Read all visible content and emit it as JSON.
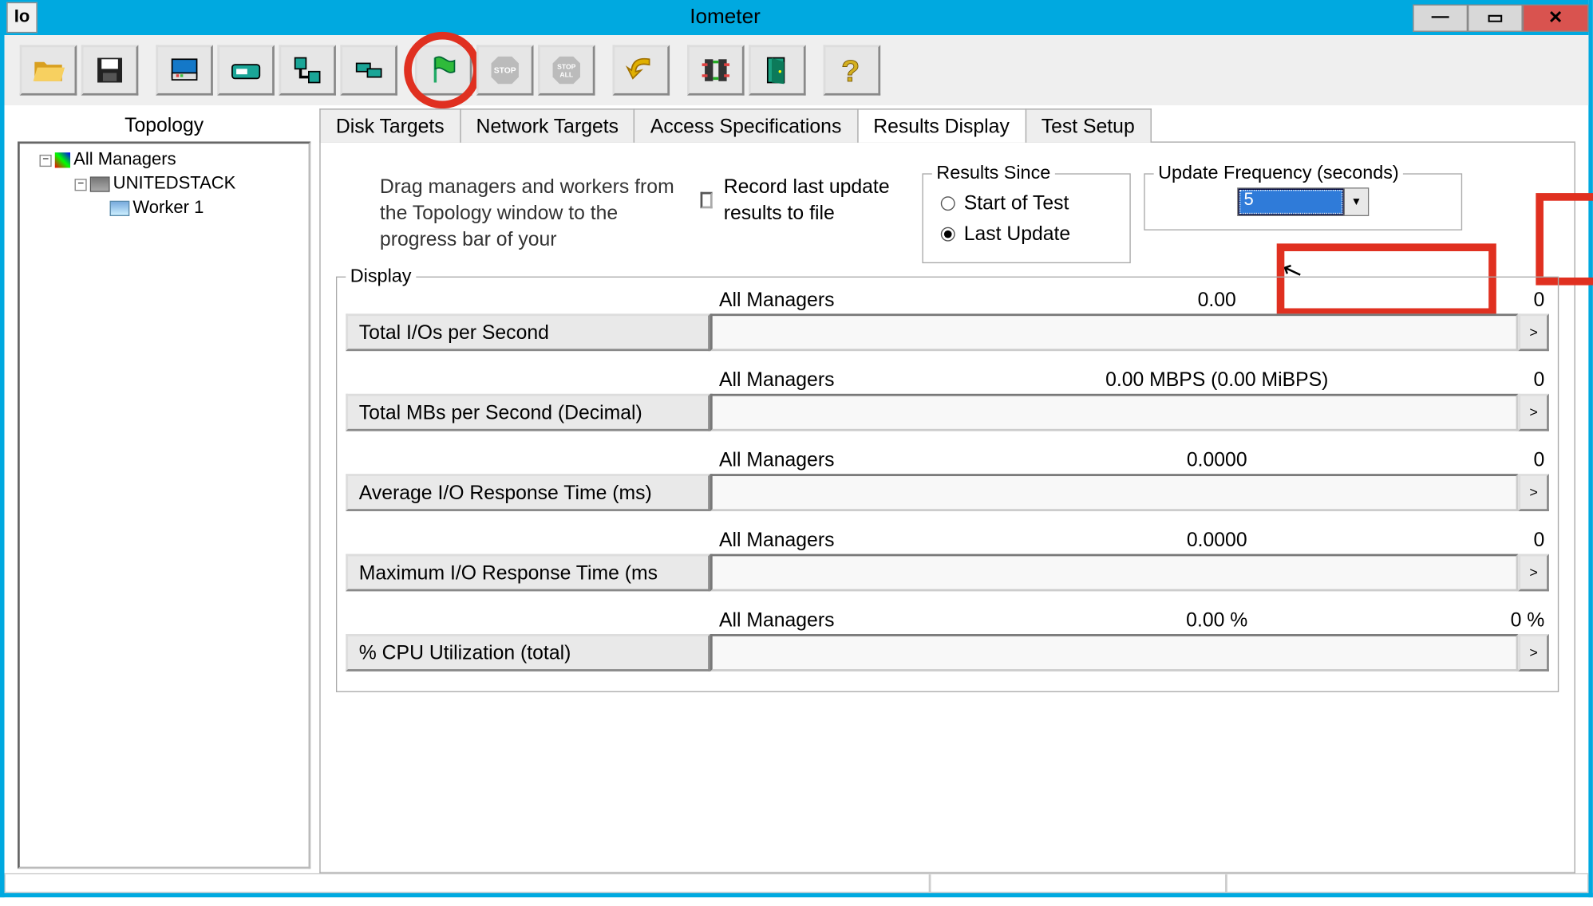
{
  "window": {
    "title": "Iometer",
    "icon_label": "Io"
  },
  "toolbar": {
    "glyphs": {
      "open": "📂",
      "save": "💾",
      "mgr": "🖥",
      "worker": "▭",
      "net": "🔗",
      "clone": "⧉",
      "flag": "⚑",
      "stop": "STOP",
      "stopall": "STOP\nALL",
      "reset": "↩",
      "collapse": "⇄",
      "exit": "🚪",
      "help": "?"
    }
  },
  "topology": {
    "title": "Topology",
    "root": "All Managers",
    "manager": "UNITEDSTACK",
    "worker": "Worker 1"
  },
  "tabs": {
    "items": [
      "Disk Targets",
      "Network Targets",
      "Access Specifications",
      "Results Display",
      "Test Setup"
    ],
    "active_index": 3
  },
  "results": {
    "drag_text": "Drag managers and workers from the Topology window to the progress bar of your",
    "record_label": "Record last update results to file",
    "results_since": {
      "legend": "Results Since",
      "option_start": "Start of Test",
      "option_last": "Last Update",
      "selected": "last"
    },
    "update_freq": {
      "legend": "Update Frequency (seconds)",
      "value": "5"
    }
  },
  "display": {
    "legend": "Display",
    "metrics": [
      {
        "name": "Total I/Os per Second",
        "scope": "All Managers",
        "value": "0.00",
        "max": "0"
      },
      {
        "name": "Total MBs per Second (Decimal)",
        "scope": "All Managers",
        "value": "0.00 MBPS (0.00 MiBPS)",
        "max": "0"
      },
      {
        "name": "Average I/O Response Time (ms)",
        "scope": "All Managers",
        "value": "0.0000",
        "max": "0"
      },
      {
        "name": "Maximum I/O Response Time (ms",
        "scope": "All Managers",
        "value": "0.0000",
        "max": "0"
      },
      {
        "name": "% CPU Utilization (total)",
        "scope": "All Managers",
        "value": "0.00 %",
        "max": "0 %"
      }
    ],
    "expand_glyph": ">"
  }
}
